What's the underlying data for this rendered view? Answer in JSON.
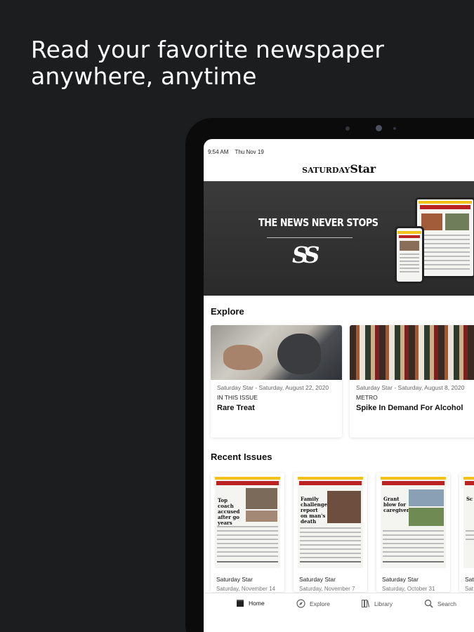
{
  "promo": {
    "headline_line1": "Read your favorite newspaper",
    "headline_line2": "anywhere, anytime"
  },
  "status_bar": {
    "time": "9:54 AM",
    "date": "Thu Nov 19"
  },
  "masthead": {
    "prefix": "SATURDAY",
    "name": "Star"
  },
  "banner": {
    "tagline": "THE NEWS NEVER STOPS",
    "logo": "SS"
  },
  "explore": {
    "title": "Explore",
    "cards": [
      {
        "meta": "Saturday Star - Saturday, August 22, 2020",
        "kicker": "IN THIS ISSUE",
        "title": "Rare Treat"
      },
      {
        "meta": "Saturday Star - Saturday, August 8, 2020",
        "kicker": "METRO",
        "title": "Spike In Demand For Alcohol"
      }
    ]
  },
  "recent": {
    "title": "Recent Issues",
    "issues": [
      {
        "name": "Saturday Star",
        "date": "Saturday, November 14",
        "headline": "Top coach accused after go years"
      },
      {
        "name": "Saturday Star",
        "date": "Saturday, November 7",
        "headline": "Family challenges report on man's death"
      },
      {
        "name": "Saturday Star",
        "date": "Saturday, October 31",
        "headline": "Grant blow for caregivers"
      },
      {
        "name": "Sat",
        "date": "Sat",
        "headline": "Sc"
      }
    ]
  },
  "tabs": [
    {
      "label": "Home",
      "icon": "home-icon",
      "active": true
    },
    {
      "label": "Explore",
      "icon": "compass-icon"
    },
    {
      "label": "Library",
      "icon": "library-icon"
    },
    {
      "label": "Search",
      "icon": "search-icon"
    }
  ],
  "colors": {
    "background": "#1c1d1f",
    "banner": "#333333",
    "accent_yellow": "#f2c21a",
    "masthead_red": "#b22222"
  }
}
